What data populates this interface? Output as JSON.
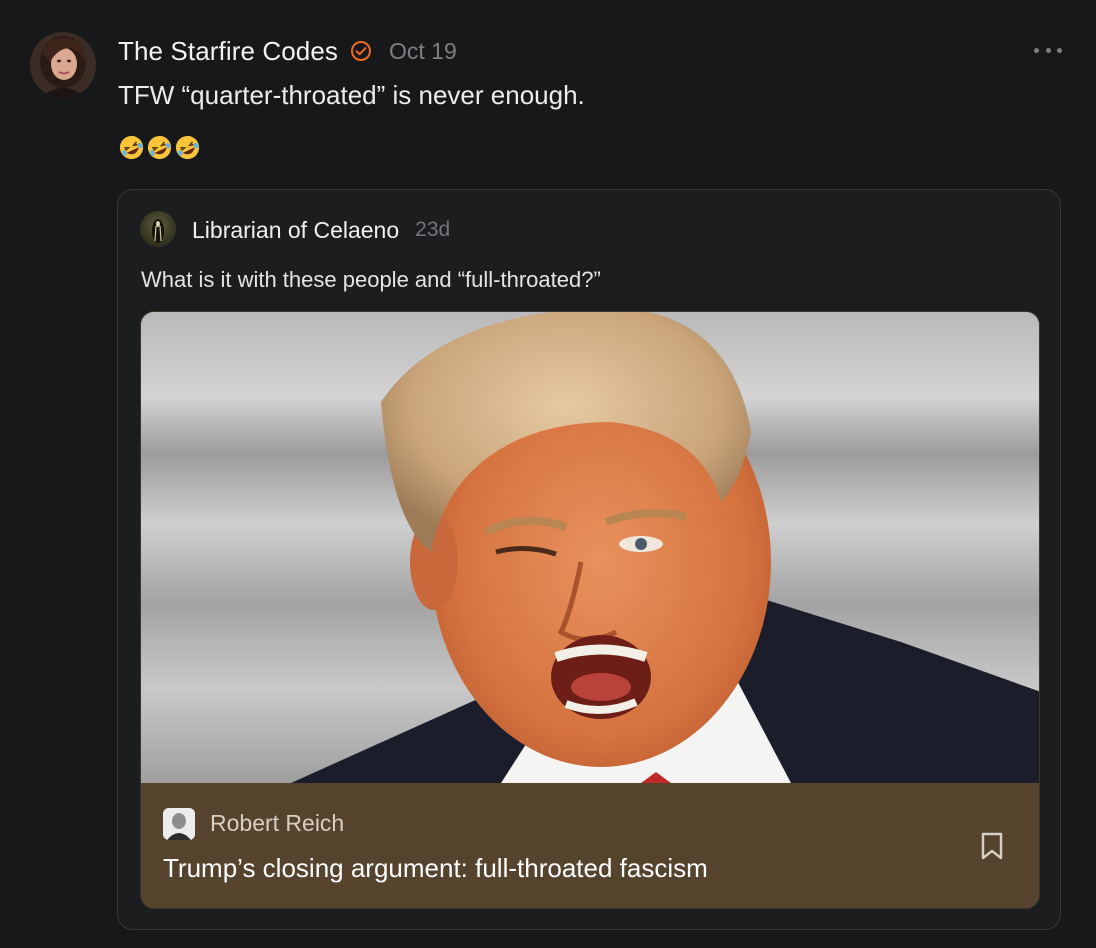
{
  "post": {
    "author": "The Starfire Codes",
    "date": "Oct 19",
    "text": "TFW “quarter-throated” is never enough.",
    "emojis": [
      "rolling-on-floor-laughing",
      "rolling-on-floor-laughing",
      "rolling-on-floor-laughing"
    ],
    "verified_color": "#f26b1d"
  },
  "quote": {
    "author": "Librarian of Celaeno",
    "date": "23d",
    "text": "What is it with these people and “full-throated?”",
    "link": {
      "publication": "Robert Reich",
      "title": "Trump’s closing argument: full-throated fascism",
      "footer_color": "#55432e"
    }
  }
}
